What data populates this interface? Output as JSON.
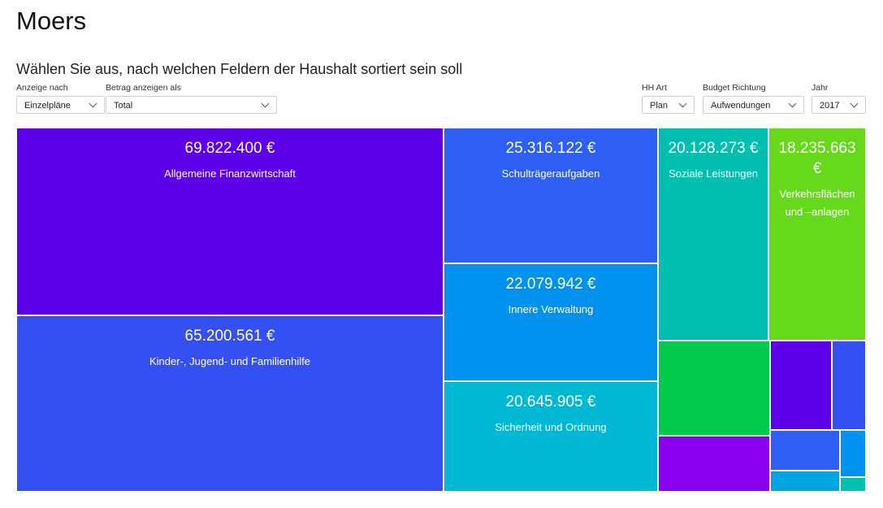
{
  "header": {
    "title": "Moers",
    "subtitle": "Wählen Sie aus, nach welchen Feldern der Haushalt sortiert sein soll"
  },
  "controls": {
    "anzeige": {
      "label": "Anzeige nach",
      "value": "Einzelpläne"
    },
    "betrag": {
      "label": "Betrag anzeigen als",
      "value": "Total"
    },
    "hh_art": {
      "label": "HH Art",
      "value": "Plan"
    },
    "budget": {
      "label": "Budget Richtung",
      "value": "Aufwendungen"
    },
    "jahr": {
      "label": "Jahr",
      "value": "2017"
    }
  },
  "chart_data": {
    "type": "treemap",
    "unit": "€",
    "items": [
      {
        "label": "Allgemeine Finanzwirtschaft",
        "value": 69822400,
        "display": "69.822.400 €",
        "color": "#5b00e8"
      },
      {
        "label": "Kinder-, Jugend- und Familienhilfe",
        "value": 65200561,
        "display": "65.200.561 €",
        "color": "#3550f2"
      },
      {
        "label": "Schulträgeraufgaben",
        "value": 25316122,
        "display": "25.316.122 €",
        "color": "#2f60f5"
      },
      {
        "label": "Innere Verwaltung",
        "value": 22079942,
        "display": "22.079.942 €",
        "color": "#0092ee"
      },
      {
        "label": "Sicherheit und Ordnung",
        "value": 20645905,
        "display": "20.645.905 €",
        "color": "#00b8d4"
      },
      {
        "label": "Soziale Leistungen",
        "value": 20128273,
        "display": "20.128.273 €",
        "color": "#00bfae"
      },
      {
        "label": "Verkehrsflächen und –anlagen",
        "value": 18235663,
        "display": "18.235.663 €",
        "color": "#66d91a"
      }
    ],
    "unlabeled_tiles": [
      {
        "color": "#00c94c"
      },
      {
        "color": "#8a00f0"
      },
      {
        "color": "#5b00e8"
      },
      {
        "color": "#3550f2"
      },
      {
        "color": "#2f60f5"
      },
      {
        "color": "#00a5e0"
      },
      {
        "color": "#0092ee"
      },
      {
        "color": "#00bfae"
      }
    ]
  }
}
